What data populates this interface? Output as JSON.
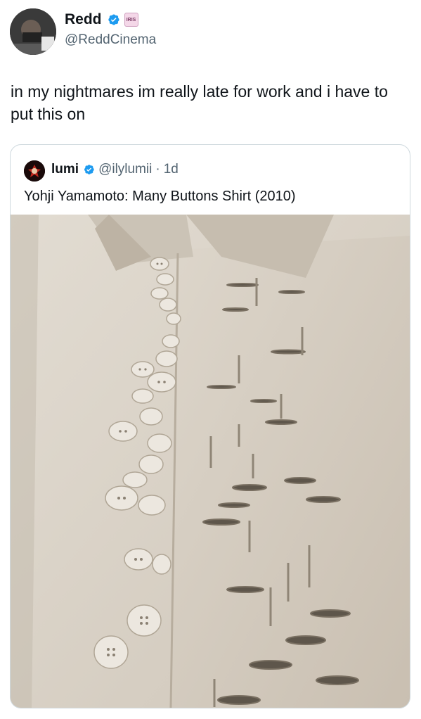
{
  "tweet": {
    "author_name": "Redd",
    "author_handle": "@ReddCinema",
    "affiliate_badge_text": "IRIS",
    "text": "in my nightmares im really late for work and i have to put this on"
  },
  "quoted_tweet": {
    "author_name": "lumi",
    "author_handle": "@ilylumii",
    "separator": "·",
    "timestamp": "1d",
    "text": "Yohji Yamamoto: Many Buttons Shirt (2010)"
  },
  "colors": {
    "verified_blue": "#1d9bf0",
    "shirt": "#d9d2c7",
    "secondary_text": "#536471"
  },
  "icons": {
    "verified": "verified-badge-icon",
    "affiliate": "affiliate-badge-icon"
  }
}
